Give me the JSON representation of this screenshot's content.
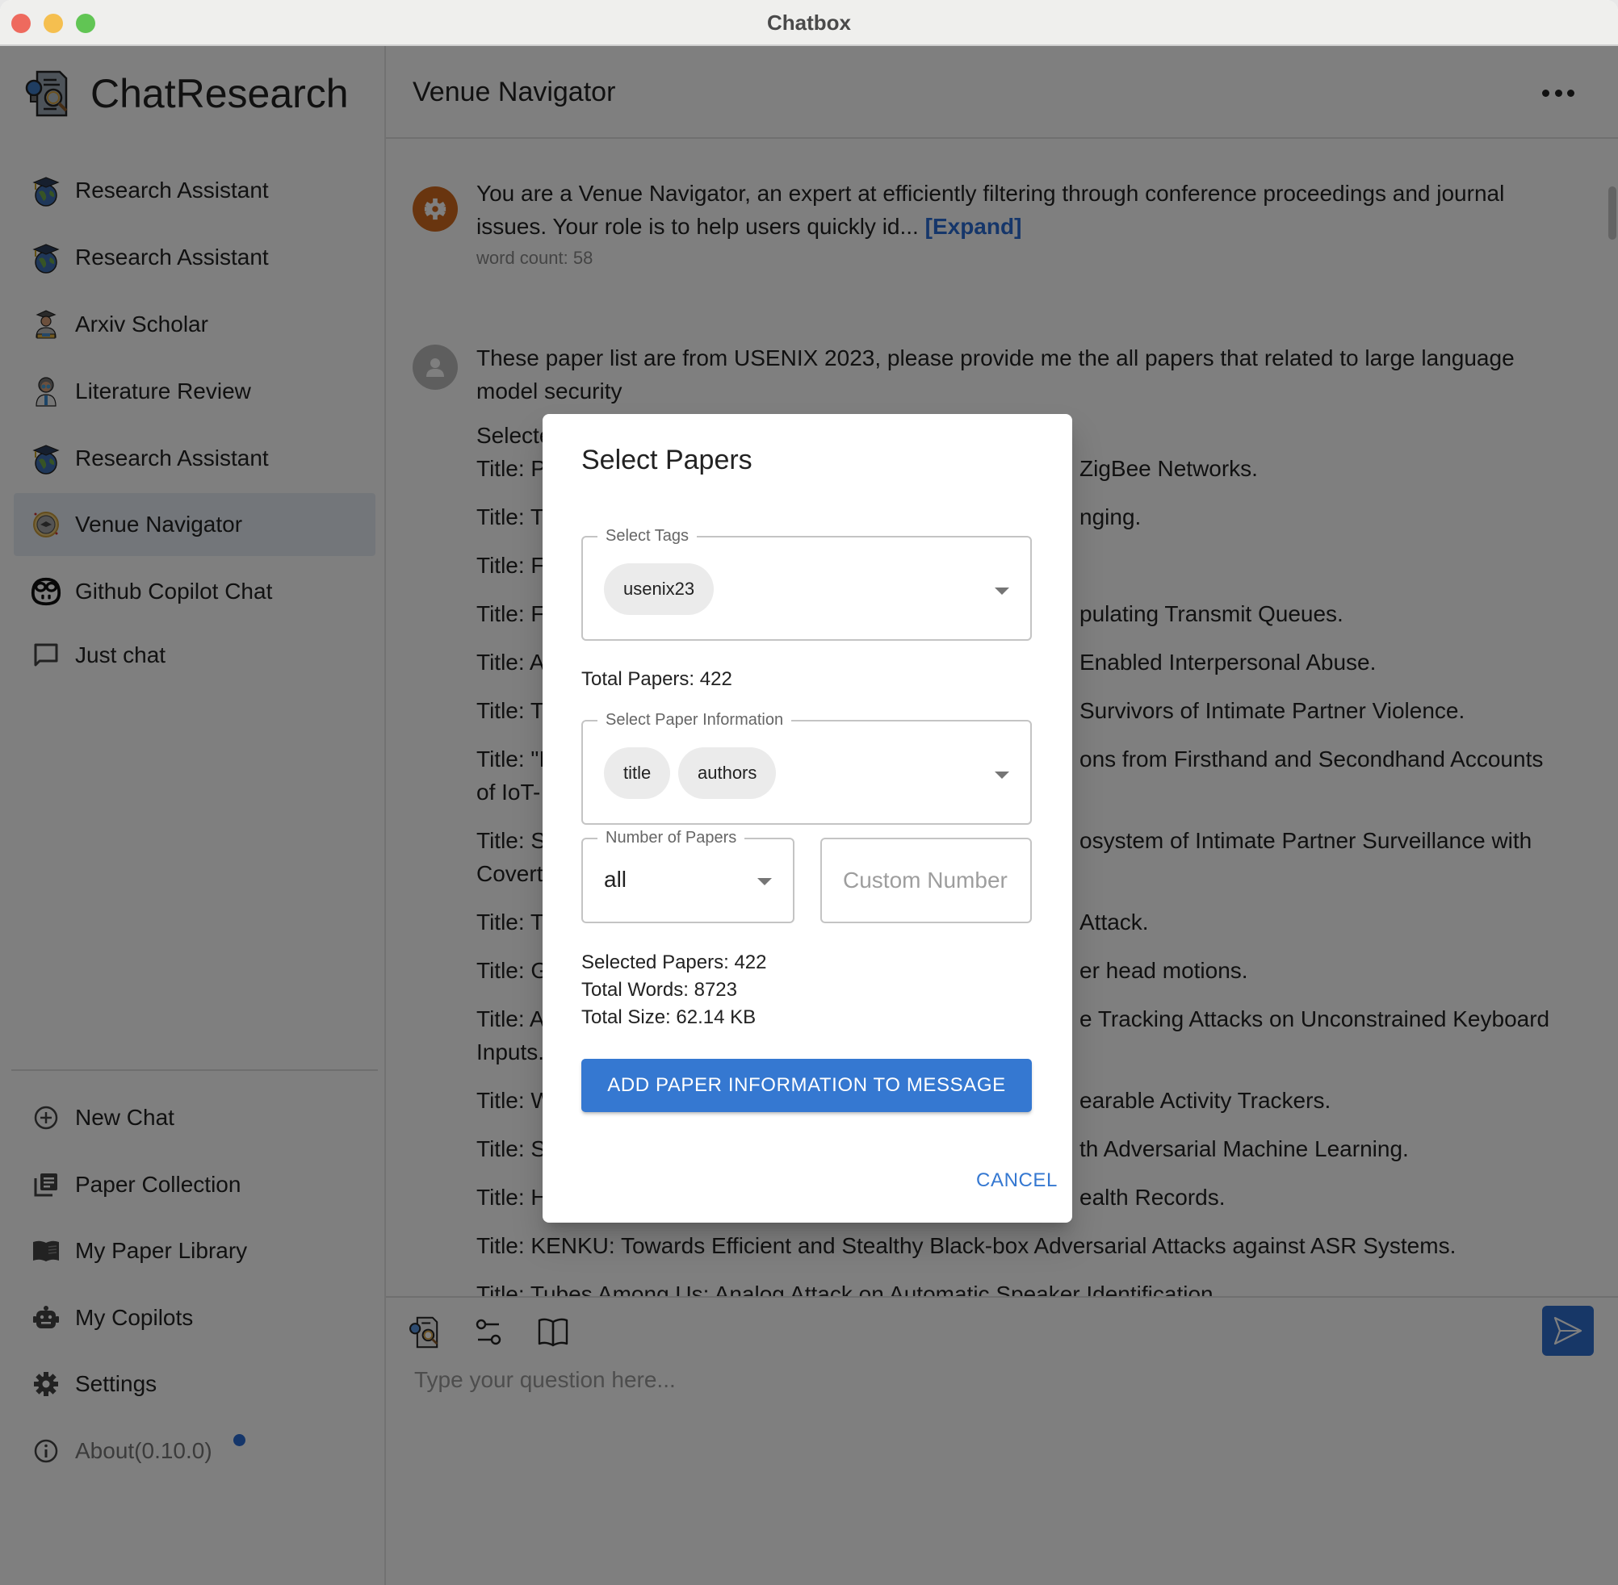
{
  "window": {
    "title": "Chatbox"
  },
  "sidebar": {
    "brand": "ChatResearch",
    "items": [
      {
        "label": "Research Assistant",
        "icon": "graduation-globe-icon"
      },
      {
        "label": "Research Assistant",
        "icon": "graduation-globe-icon"
      },
      {
        "label": "Arxiv Scholar",
        "icon": "scholar-avatar-icon"
      },
      {
        "label": "Literature Review",
        "icon": "scientist-avatar-icon"
      },
      {
        "label": "Research Assistant",
        "icon": "graduation-globe-icon"
      },
      {
        "label": "Venue Navigator",
        "icon": "venue-badge-icon",
        "active": true
      },
      {
        "label": "Github Copilot Chat",
        "icon": "copilot-icon"
      },
      {
        "label": "Just chat",
        "icon": "chat-bubble-icon"
      }
    ],
    "bottom_items": [
      {
        "label": "New Chat",
        "icon": "add-circle-icon"
      },
      {
        "label": "Paper Collection",
        "icon": "library-icon"
      },
      {
        "label": "My Paper Library",
        "icon": "book-icon"
      },
      {
        "label": "My Copilots",
        "icon": "robot-icon"
      },
      {
        "label": "Settings",
        "icon": "gear-icon"
      },
      {
        "label": "About(0.10.0)",
        "icon": "info-icon",
        "badge": true
      }
    ]
  },
  "chat": {
    "title": "Venue Navigator",
    "system_message": {
      "text": "You are a Venue Navigator, an expert at efficiently filtering through conference proceedings and journal issues. Your role is to help users quickly id...",
      "expand_label": "[Expand]",
      "word_count": "word count: 58"
    },
    "user_message": {
      "prompt": "These paper list are from USENIX 2023, please provide me the all papers that related to large language model security",
      "lines": [
        {
          "left": "Selecte",
          "right": ""
        },
        {
          "left": "Title: P",
          "right": "ZigBee Networks."
        },
        {
          "left": "Title: T",
          "right": "nging."
        },
        {
          "left": "Title: F",
          "right": ""
        },
        {
          "left": "Title: F",
          "right": "pulating Transmit Queues."
        },
        {
          "left": "Title: A",
          "right": "Enabled Interpersonal Abuse."
        },
        {
          "left": "Title: T",
          "right": "Survivors of Intimate Partner Violence."
        },
        {
          "left": "Title: \"I",
          "right": "ons from Firsthand and Secondhand Accounts",
          "left2": "of IoT-"
        },
        {
          "left": "Title: S",
          "right": "osystem of Intimate Partner Surveillance with",
          "left2": "Covert"
        },
        {
          "left": "Title: T",
          "right": "Attack."
        },
        {
          "left": "Title: G",
          "right": "er head motions."
        },
        {
          "left": "Title: A",
          "right": "e Tracking Attacks on Unconstrained Keyboard",
          "left2": "Inputs."
        },
        {
          "left": "Title: W",
          "right": "earable Activity Trackers."
        },
        {
          "left": "Title: S",
          "right": "th Adversarial Machine Learning."
        },
        {
          "left": "Title: H",
          "right": "ealth Records."
        }
      ],
      "full_lines": [
        "Title: KENKU: Towards Efficient and Stealthy Black-box Adversarial Attacks against ASR Systems.",
        "Title: Tubes Among Us: Analog Attack on Automatic Speaker Identification."
      ]
    },
    "input": {
      "placeholder": "Type your question here..."
    },
    "toolbar": [
      "paper-search-icon",
      "sliders-icon",
      "open-book-icon"
    ]
  },
  "modal": {
    "title": "Select Papers",
    "tags": {
      "label": "Select Tags",
      "selected": [
        "usenix23"
      ]
    },
    "total_papers": "Total Papers: 422",
    "paper_info": {
      "label": "Select Paper Information",
      "selected": [
        "title",
        "authors"
      ]
    },
    "number_of_papers": {
      "label": "Number of Papers",
      "value": "all"
    },
    "custom_number": {
      "placeholder": "Custom Number",
      "value": ""
    },
    "stats": {
      "selected": "Selected Papers: 422",
      "words": "Total Words: 8723",
      "size": "Total Size: 62.14 KB"
    },
    "add_button": "ADD PAPER INFORMATION TO MESSAGE",
    "cancel_button": "CANCEL"
  },
  "colors": {
    "accent": "#3578d1",
    "system_avatar": "#d26b1f",
    "badge": "#2b6cd4"
  }
}
